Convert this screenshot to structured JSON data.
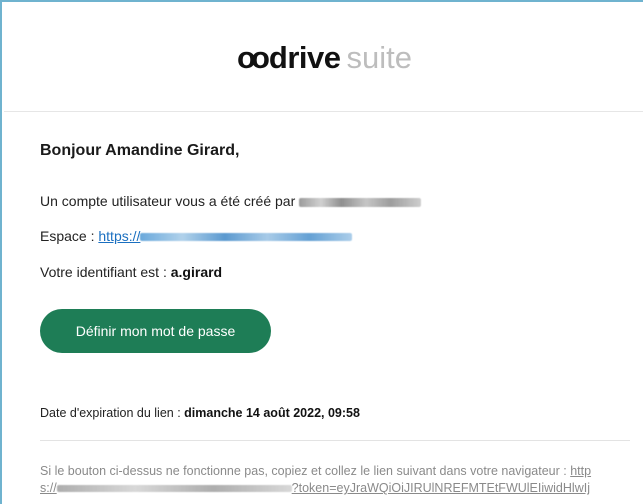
{
  "logo": {
    "mark": "oo",
    "brand": "drive",
    "suffix": "suite"
  },
  "greeting": "Bonjour Amandine Girard,",
  "body": {
    "created_by_prefix": "Un compte utilisateur vous a été créé par",
    "space_label": "Espace :",
    "space_link_prefix": "https://",
    "identifier_prefix": "Votre identifiant est :",
    "identifier_value": "a.girard"
  },
  "cta_label": "Définir mon mot de passe",
  "expiry": {
    "label": "Date d'expiration du lien :",
    "value": "dimanche 14 août 2022, 09:58"
  },
  "fallback": {
    "text": "Si le bouton ci-dessus ne fonctionne pas, copiez et collez le lien suivant dans votre navigateur :",
    "link_line1_visible": "http",
    "link_line2_prefix": "s://",
    "link_line2_suffix": "?token=eyJraWQiOiJIRUlNREFMTEtFWUlEIiwidHlwIj"
  },
  "colors": {
    "accent": "#1e7d56",
    "link": "#1a6fc0",
    "frame": "#6fb3cf",
    "muted": "#8a8a8a"
  }
}
